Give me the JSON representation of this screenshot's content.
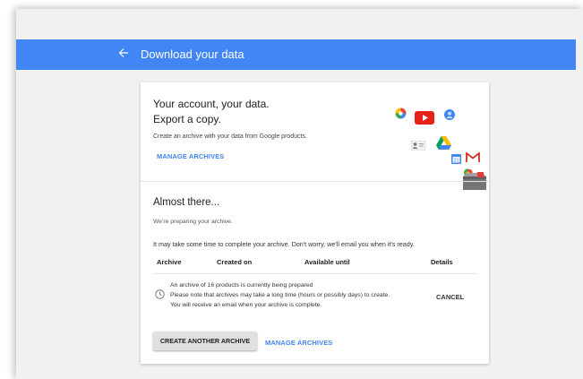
{
  "header": {
    "back_icon": "arrow-left-icon",
    "title": "Download your data"
  },
  "intro": {
    "heading_line1": "Your account, your data.",
    "heading_line2": "Export a copy.",
    "subtext": "Create an archive with your data from Google products.",
    "manage_link": "MANAGE ARCHIVES",
    "product_icons": [
      "google-photos-icon",
      "youtube-icon",
      "profile-icon",
      "contacts-icon",
      "google-drive-icon",
      "google-calendar-icon",
      "gmail-icon",
      "maps-icon",
      "archive-box-icon"
    ]
  },
  "status": {
    "heading": "Almost there...",
    "preparing": "We're preparing your archive.",
    "notice": "It may take some time to complete your archive. Don't worry, we'll email you when it's ready."
  },
  "table": {
    "columns": [
      "Archive",
      "Created on",
      "Available until",
      "Details"
    ],
    "row": {
      "icon": "clock-icon",
      "line1": "An archive of 16 products is currently being prepared",
      "line2": "Please note that archives may take a long time (hours or possibly days) to create.",
      "line3": "You will receive an email when your archive is complete.",
      "cancel": "CANCEL"
    }
  },
  "actions": {
    "create_another": "CREATE ANOTHER ARCHIVE",
    "manage_link": "MANAGE ARCHIVES"
  },
  "colors": {
    "header_blue": "#4285f4",
    "link_blue": "#4285f4",
    "background": "#f1f1f1",
    "card": "#ffffff"
  }
}
